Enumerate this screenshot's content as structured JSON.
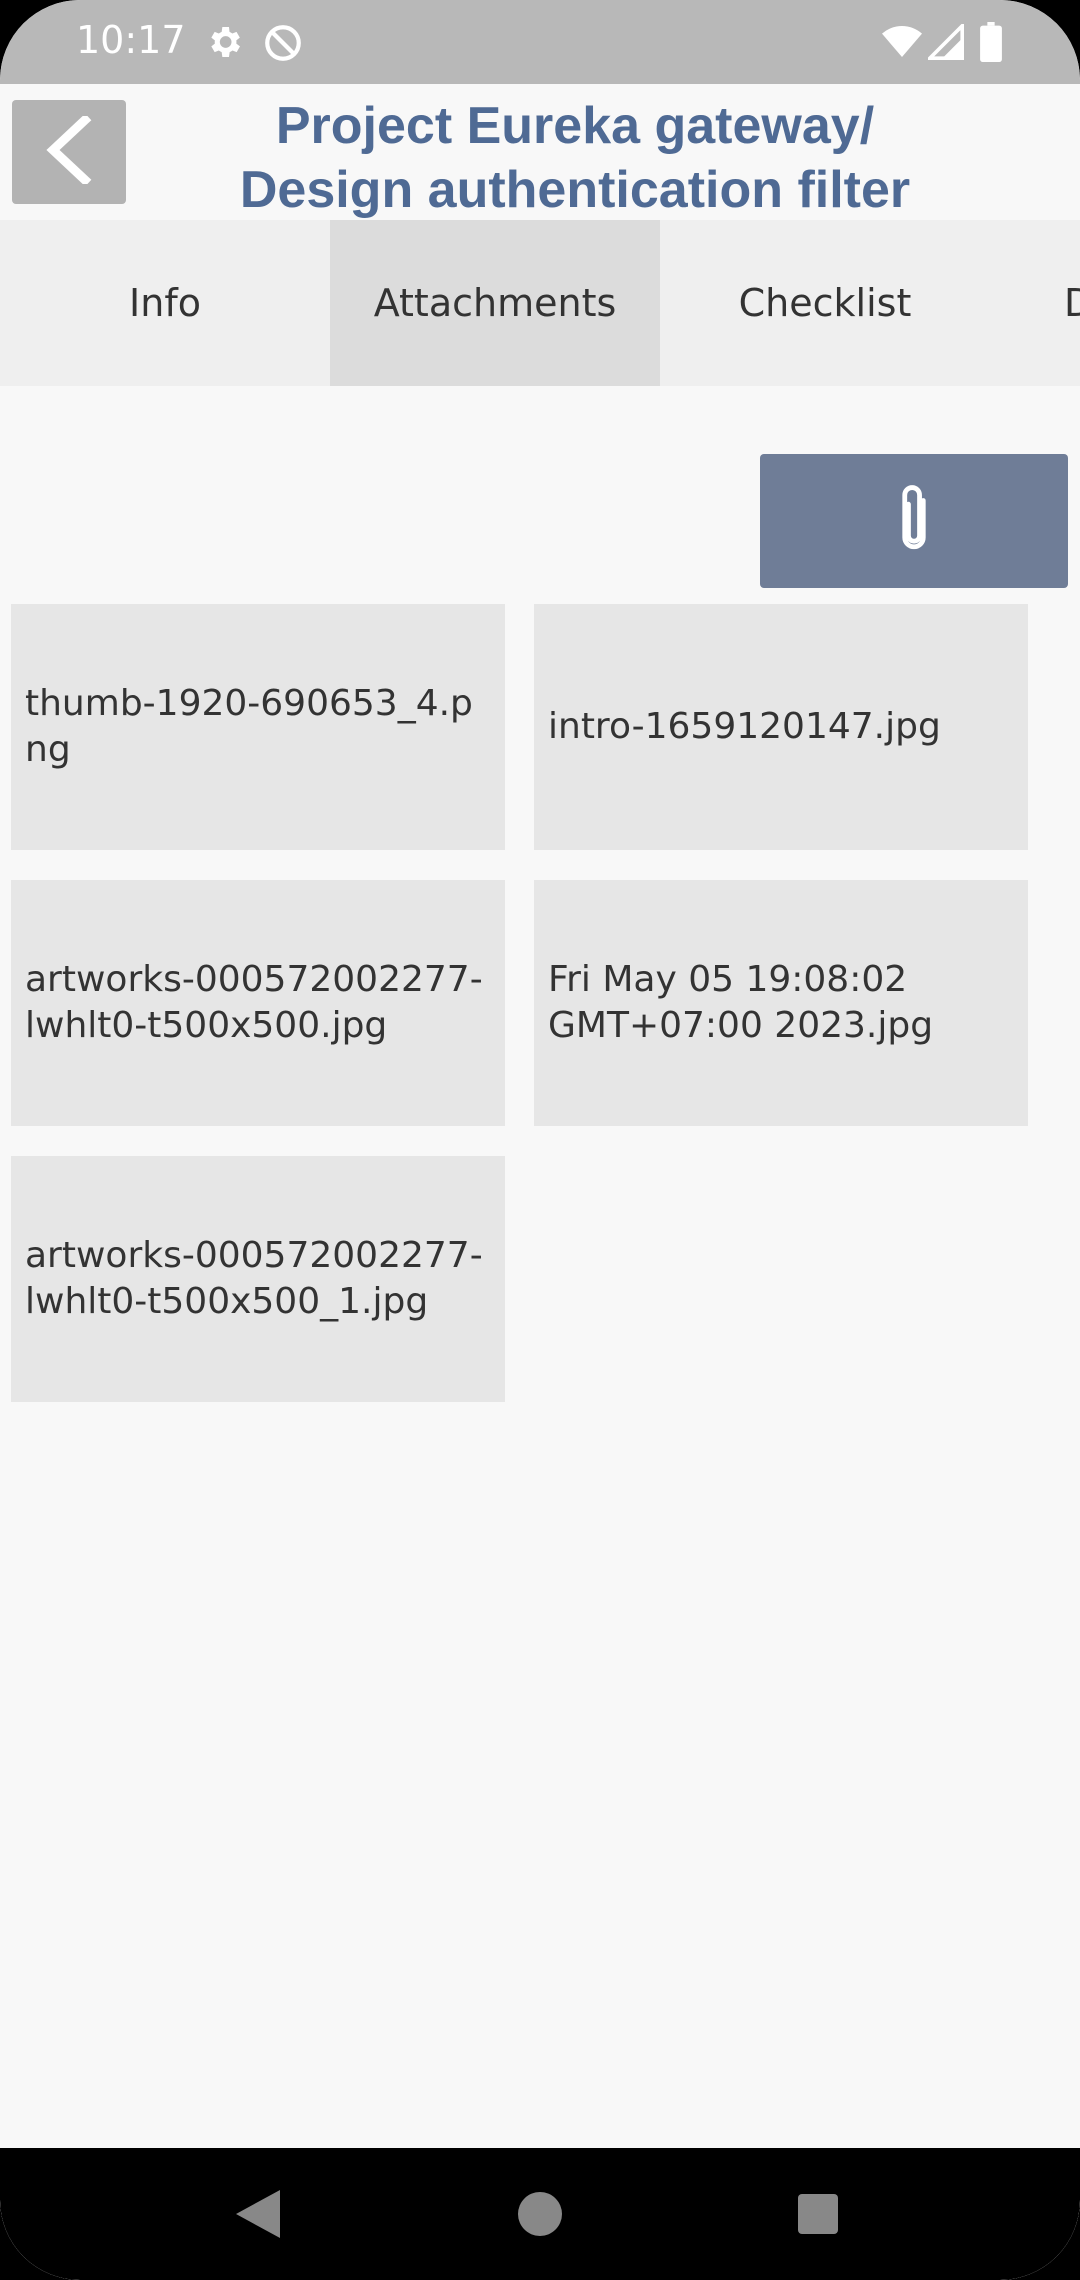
{
  "status_bar": {
    "time": "10:17",
    "icons": [
      "settings-gear-icon",
      "data-saver-icon",
      "wifi-icon",
      "signal-icon",
      "battery-icon"
    ]
  },
  "header": {
    "back_icon": "chevron-left-icon",
    "title_line1": "Project Eureka gateway/",
    "title_line2": "Design authentication filter"
  },
  "tabs": [
    {
      "label": "Info",
      "active": false
    },
    {
      "label": "Attachments",
      "active": true
    },
    {
      "label": "Checklist",
      "active": false
    },
    {
      "label": "D",
      "active": false
    }
  ],
  "attach_button": {
    "icon": "paperclip-icon"
  },
  "attachments": [
    {
      "name": "thumb-1920-690653_4.png"
    },
    {
      "name": "intro-1659120147.jpg"
    },
    {
      "name": "artworks-000572002277-lwhlt0-t500x500.jpg"
    },
    {
      "name": "Fri May 05 19:08:02 GMT+07:00 2023.jpg"
    },
    {
      "name": "artworks-000572002277-lwhlt0-t500x500_1.jpg"
    }
  ],
  "nav_bar": {
    "icons": [
      "back-triangle-icon",
      "home-circle-icon",
      "recents-square-icon"
    ]
  },
  "colors": {
    "accent": "#4f6a94",
    "attach_button": "#6f7d97",
    "active_tab": "#dcdcdc",
    "tile": "#e6e6e6"
  }
}
